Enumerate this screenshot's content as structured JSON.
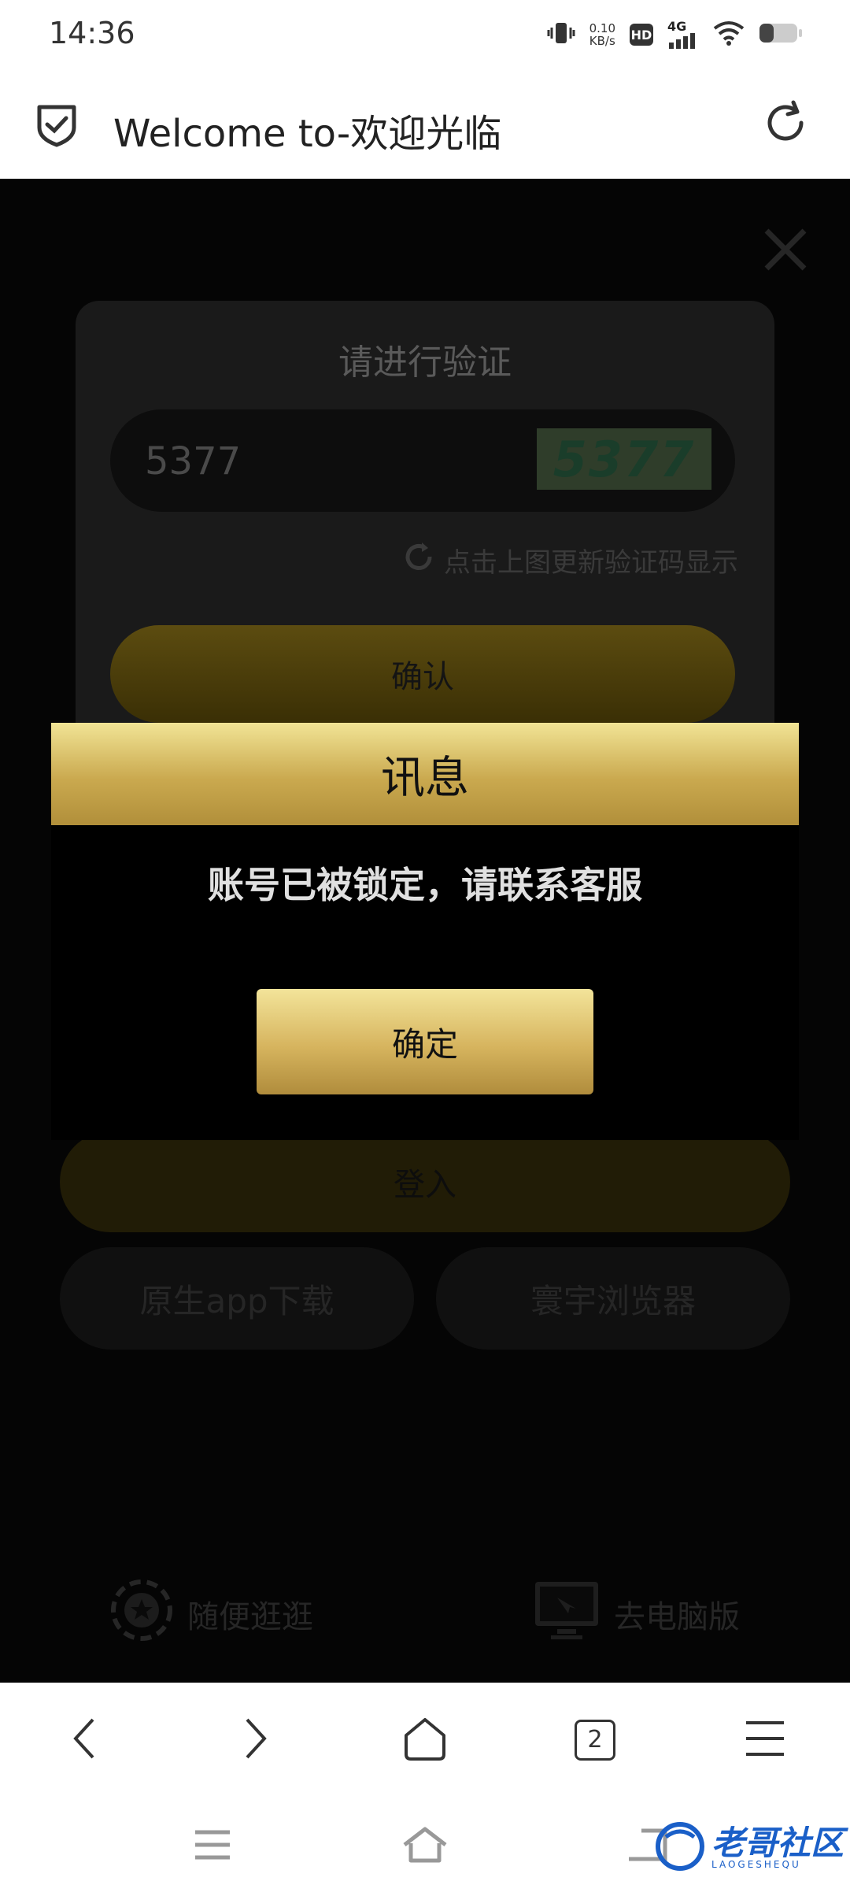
{
  "status_bar": {
    "time": "14:36",
    "net_speed_value": "0.10",
    "net_speed_unit": "KB/s",
    "hd": "HD",
    "network": "4G"
  },
  "address_bar": {
    "title": "Welcome to-欢迎光临"
  },
  "verify_card": {
    "title": "请进行验证",
    "captcha_value": "5377",
    "captcha_image_text": "5377",
    "refresh_hint": "点击上图更新验证码显示",
    "confirm_label": "确认"
  },
  "page": {
    "login_label": "登入",
    "app_download_label": "原生app下载",
    "universe_browser_label": "寰宇浏览器",
    "browse_label": "随便逛逛",
    "desktop_label": "去电脑版"
  },
  "dialog": {
    "title": "讯息",
    "message": "账号已被锁定，请联系客服",
    "ok_label": "确定"
  },
  "toolbar": {
    "tab_count": "2"
  },
  "watermark": {
    "text": "老哥社区",
    "subtext": "LAOGESHEQU"
  },
  "colors": {
    "gold_light": "#f1e495",
    "gold_dark": "#b18f3a",
    "page_bg": "#050505"
  }
}
